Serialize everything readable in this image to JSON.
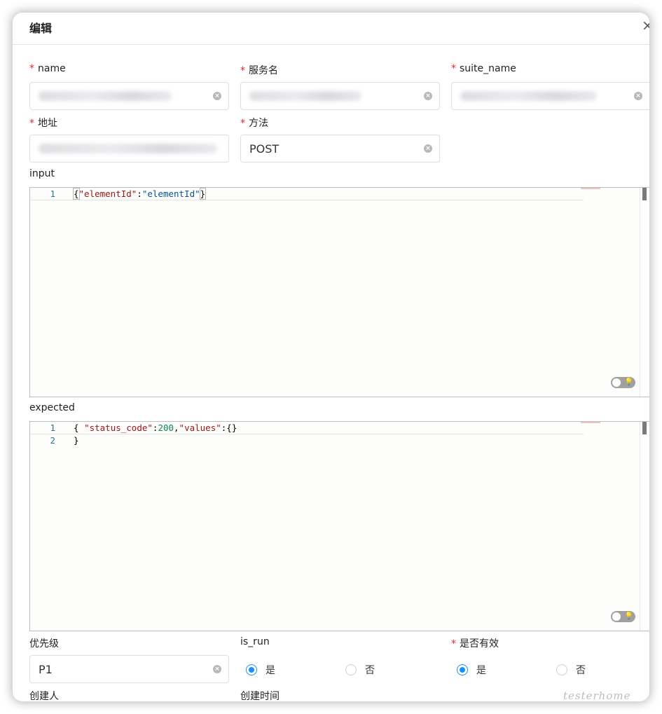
{
  "modal": {
    "title": "编辑",
    "close_icon": "×"
  },
  "form": {
    "name": {
      "label": "name",
      "required_mark": "*"
    },
    "service_name": {
      "label": "服务名",
      "required_mark": "*"
    },
    "suite_name": {
      "label": "suite_name",
      "required_mark": "*"
    },
    "address": {
      "label": "地址",
      "required_mark": "*"
    },
    "method": {
      "label": "方法",
      "required_mark": "*",
      "value": "POST"
    },
    "input": {
      "label": "input",
      "lines": [
        {
          "number": "1",
          "code": "{\"elementId\":\"elementId\"}"
        }
      ]
    },
    "expected": {
      "label": "expected",
      "lines": [
        {
          "number": "1",
          "code": "{ \"status_code\":200,\"values\":{}"
        },
        {
          "number": "2",
          "code": "}"
        }
      ]
    },
    "priority": {
      "label": "优先级",
      "value": "P1"
    },
    "is_run": {
      "label": "is_run",
      "options": [
        "是",
        "否"
      ],
      "selected": "是"
    },
    "is_valid": {
      "label": "是否有效",
      "required_mark": "*",
      "options": [
        "是",
        "否"
      ],
      "selected": "是"
    },
    "creator": {
      "label": "创建人"
    },
    "created_time": {
      "label": "创建时间"
    }
  },
  "watermark": "testerhome",
  "colors": {
    "accent": "#1890ff",
    "required": "#f5222d",
    "key": "#a31515",
    "string": "#0451a5",
    "number": "#098658"
  },
  "icons": {
    "clear": "clear-icon",
    "close": "close-icon",
    "lightbulb": "lightbulb-icon"
  }
}
